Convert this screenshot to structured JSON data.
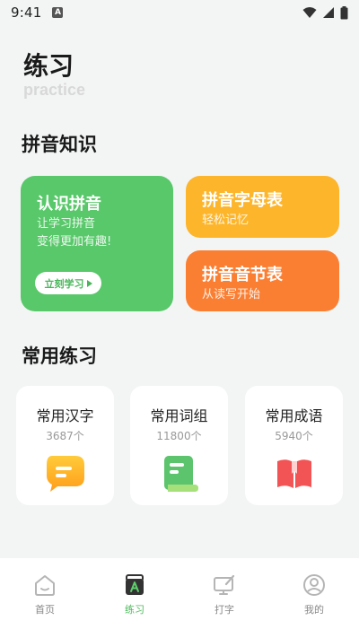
{
  "status_bar": {
    "time": "9:41",
    "notification_badge": "A"
  },
  "header": {
    "title": "练习",
    "subtitle": "practice"
  },
  "pinyin_section": {
    "title": "拼音知识",
    "cards": [
      {
        "title": "认识拼音",
        "subtitle_lines": [
          "让学习拼音",
          "变得更加有趣!"
        ],
        "button_label": "立刻学习",
        "color": "#58c86a"
      },
      {
        "title": "拼音字母表",
        "subtitle": "轻松记忆",
        "color": "#fdb52b"
      },
      {
        "title": "拼音音节表",
        "subtitle": "从读写开始",
        "color": "#fb7f33"
      }
    ]
  },
  "common_section": {
    "title": "常用练习",
    "items": [
      {
        "title": "常用汉字",
        "count": "3687个",
        "icon": "chat-bubble-icon"
      },
      {
        "title": "常用词组",
        "count": "11800个",
        "icon": "scroll-icon"
      },
      {
        "title": "常用成语",
        "count": "5940个",
        "icon": "open-book-icon"
      }
    ]
  },
  "bottom_nav": {
    "active_index": 1,
    "items": [
      {
        "label": "首页",
        "icon": "home-icon"
      },
      {
        "label": "练习",
        "icon": "practice-book-icon"
      },
      {
        "label": "打字",
        "icon": "typing-icon"
      },
      {
        "label": "我的",
        "icon": "profile-icon"
      }
    ]
  },
  "colors": {
    "accent_green": "#4cbb5c",
    "background": "#f3f5f5"
  }
}
